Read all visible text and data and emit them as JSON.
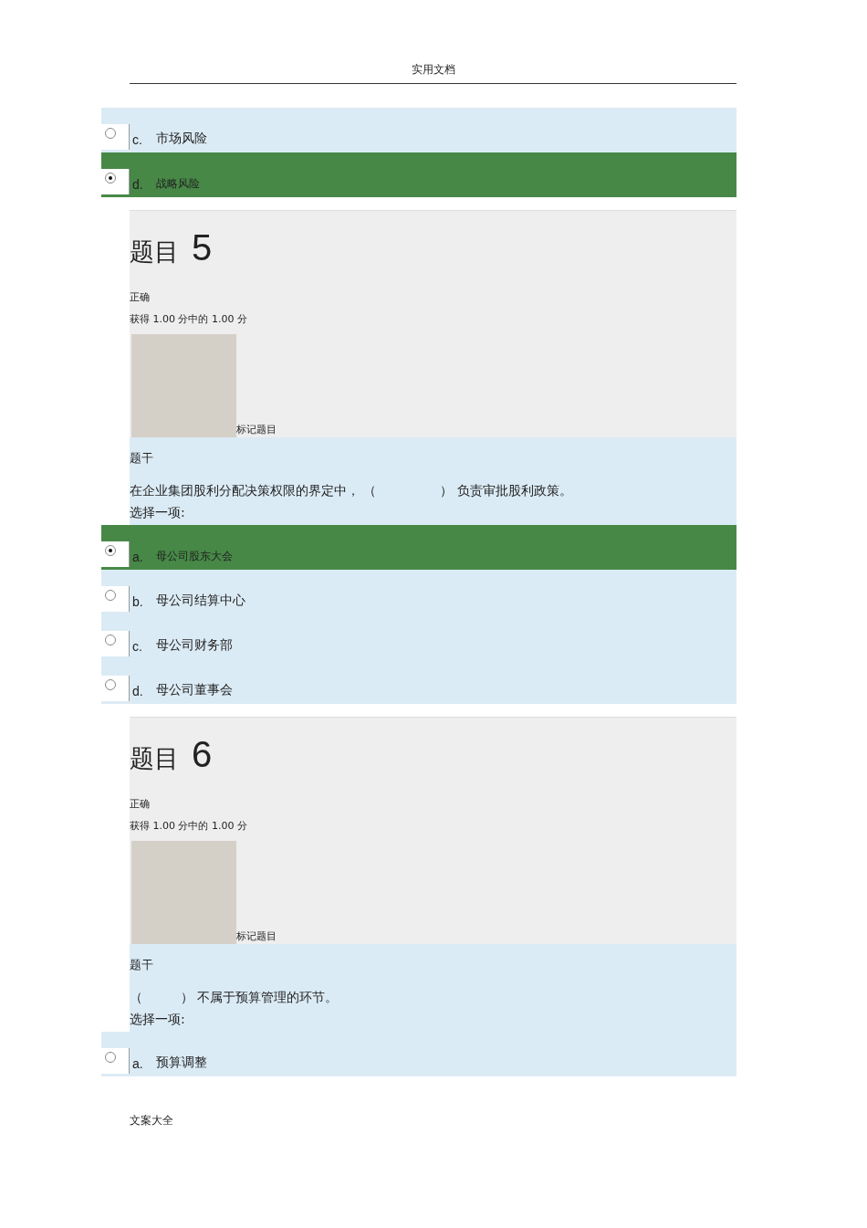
{
  "header": "实用文档",
  "leading_options": [
    {
      "letter": "c.",
      "text": "市场风险",
      "selected": false
    },
    {
      "letter": "d.",
      "text": "战略风险",
      "selected": true
    }
  ],
  "questions": [
    {
      "label": "题目",
      "number": "5",
      "status": "正确",
      "score": "获得 1.00 分中的 1.00 分",
      "flag": "标记题目",
      "stem_heading": "题干",
      "stem": "在企业集团股利分配决策权限的界定中， （　　　　　） 负责审批股利政策。",
      "prompt": "选择一项:",
      "options": [
        {
          "letter": "a.",
          "text": "母公司股东大会",
          "selected": true
        },
        {
          "letter": "b.",
          "text": "母公司结算中心",
          "selected": false
        },
        {
          "letter": "c.",
          "text": "母公司财务部",
          "selected": false
        },
        {
          "letter": "d.",
          "text": "母公司董事会",
          "selected": false
        }
      ]
    },
    {
      "label": "题目",
      "number": "6",
      "status": "正确",
      "score": "获得 1.00 分中的 1.00 分",
      "flag": "标记题目",
      "stem_heading": "题干",
      "stem": "（　　　） 不属于预算管理的环节。",
      "prompt": "选择一项:",
      "options": [
        {
          "letter": "a.",
          "text": "预算调整",
          "selected": false
        }
      ]
    }
  ],
  "footer": "文案大全"
}
